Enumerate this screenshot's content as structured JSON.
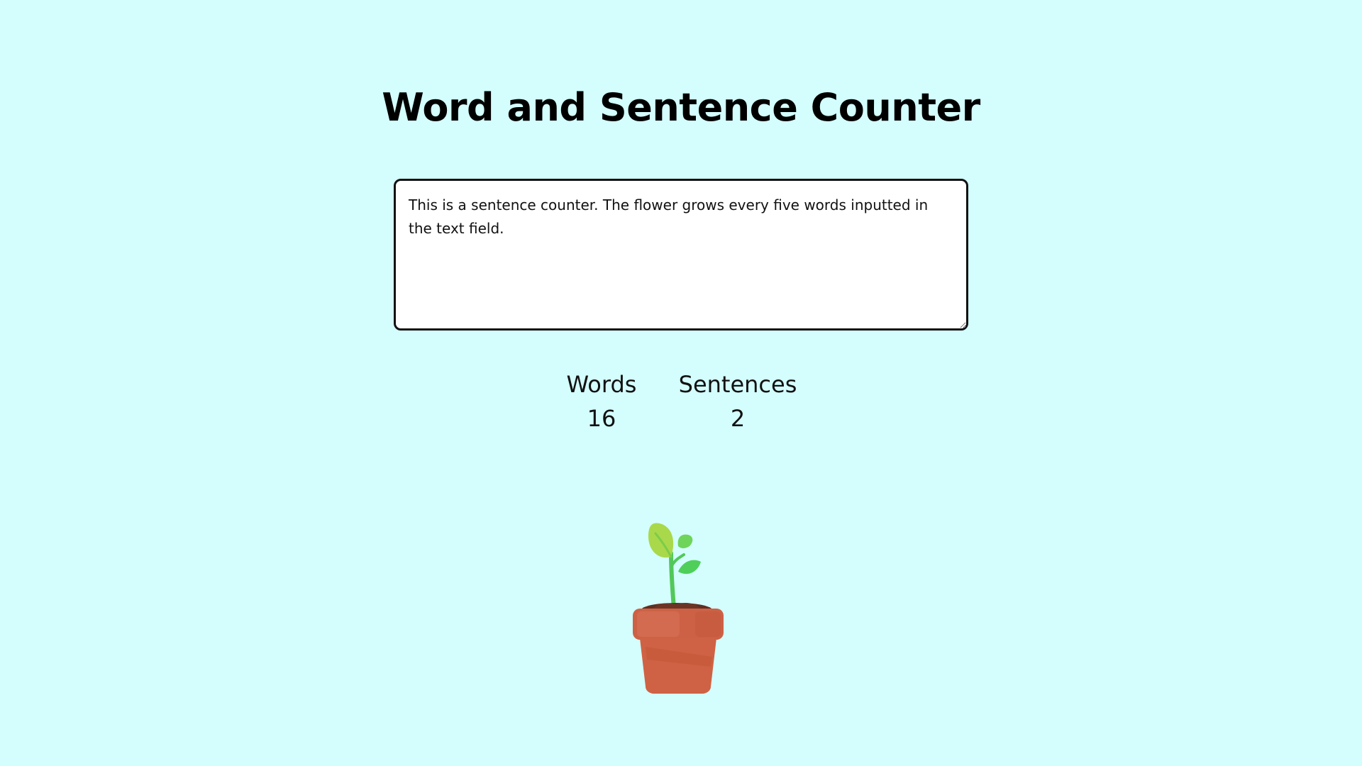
{
  "page": {
    "title": "Word and Sentence Counter",
    "background_color": "#d4fefe"
  },
  "editor": {
    "value": "This is a sentence counter. The flower grows every five words inputted in the text field.",
    "placeholder": ""
  },
  "stats": {
    "words_label": "Words",
    "words_value": "16",
    "sentences_label": "Sentences",
    "sentences_value": "2"
  },
  "illustration": {
    "icon": "potted-sprout-icon",
    "pot_color": "#cd6145",
    "leaf_color": "#5ccf52"
  }
}
